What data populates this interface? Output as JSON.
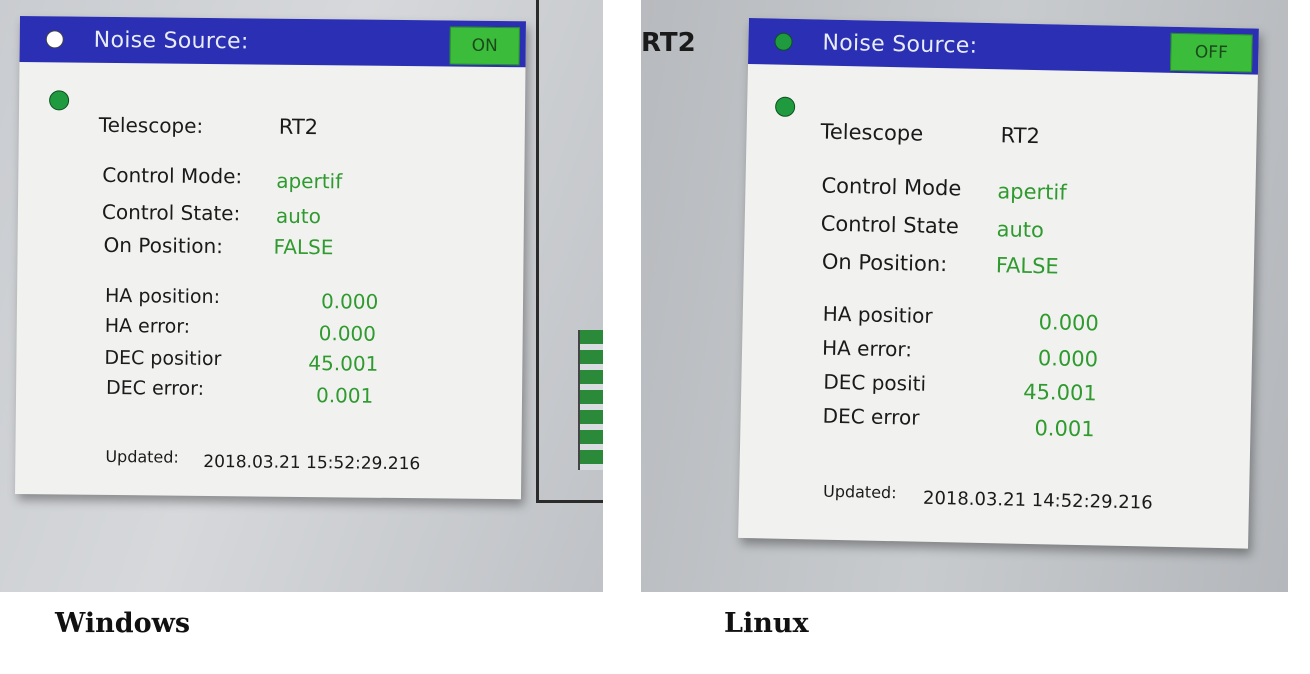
{
  "colors": {
    "titlebar": "#2a2fb4",
    "on_toggle": "#3bbd3b",
    "value_green": "#2f9a2f",
    "led_green": "#1f9a3e"
  },
  "windows": {
    "caption": "Windows",
    "panel": {
      "title": "Noise Source:",
      "title_indicator_color": "#ffffff",
      "toggle_label": "ON",
      "telescope_label": "Telescope:",
      "telescope_value": "RT2",
      "control_mode_label": "Control Mode:",
      "control_mode_value": "apertif",
      "control_state_label": "Control State:",
      "control_state_value": "auto",
      "on_position_label": "On Position:",
      "on_position_value": "FALSE",
      "ha_position_label": "HA position:",
      "ha_position_value": "0.000",
      "ha_error_label": "HA error:",
      "ha_error_value": "0.000",
      "dec_position_label": "DEC positior",
      "dec_position_value": "45.001",
      "dec_error_label": "DEC error:",
      "dec_error_value": "0.001",
      "updated_label": "Updated:",
      "updated_value": "2018.03.21 15:52:29.216"
    }
  },
  "linux": {
    "caption": "Linux",
    "corner_label": "RT2",
    "panel": {
      "title": "Noise Source:",
      "title_indicator_color": "#1f9a3e",
      "toggle_label": "OFF",
      "telescope_label": "Telescope",
      "telescope_value": "RT2",
      "control_mode_label": "Control Mode",
      "control_mode_value": "apertif",
      "control_state_label": "Control State",
      "control_state_value": "auto",
      "on_position_label": "On Position:",
      "on_position_value": "FALSE",
      "ha_position_label": "HA positior",
      "ha_position_value": "0.000",
      "ha_error_label": "HA error:",
      "ha_error_value": "0.000",
      "dec_position_label": "DEC positi",
      "dec_position_value": "45.001",
      "dec_error_label": "DEC error",
      "dec_error_value": "0.001",
      "updated_label": "Updated:",
      "updated_value": "2018.03.21 14:52:29.216"
    }
  }
}
